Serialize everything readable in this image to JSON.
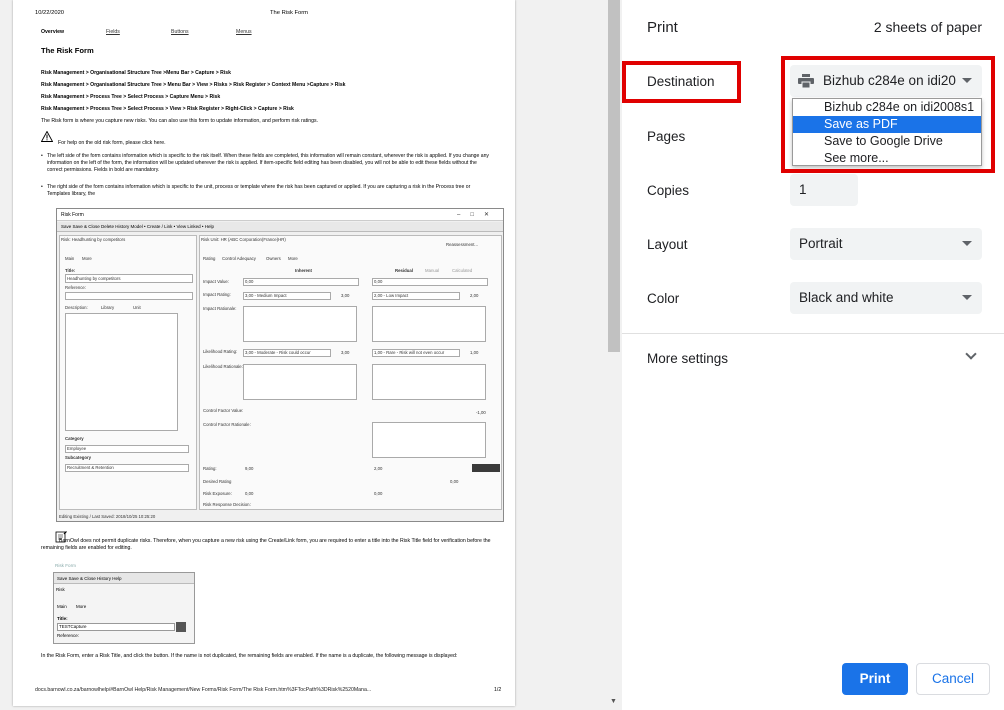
{
  "preview": {
    "header_date": "10/22/2020",
    "header_title": "The Risk Form",
    "nav": [
      "Overview",
      "Fields",
      "Buttons",
      "Menus"
    ],
    "doc_title": "The Risk Form",
    "crumbs": [
      "Risk Management > Organisational Structure Tree >Menu Bar > Capture > Risk",
      "Risk Management > Organisational Structure Tree > Menu Bar > View > Risks > Risk Register > Context Menu >Capture > Risk",
      "Risk Management > Process Tree > Select Process > Capture Menu > Risk",
      "Risk Management > Process Tree > Select Process > View > Risk Register > Right-Click > Capture > Risk"
    ],
    "intro": "The Risk form is where you capture new risks. You can also use this form to update information, and perform risk ratings.",
    "help_text": "For help on the old risk form, please click here.",
    "bullets": [
      "The left side of the form contains information which is specific to the risk itself. When these fields are completed, this information will remain constant, wherever the risk is applied. If you change any information on the left of the form, the information will be updated wherever the risk is applied. If item-specific field editing has been disabled, you will not be able to edit these fields without the correct permissions. Fields in bold are mandatory.",
      "The right side of the form contains information which is specific to the unit, process or template where the risk has been captured or applied. If you are capturing a risk in the Process tree or Templates library, the"
    ],
    "shot": {
      "window_title": "Risk Form",
      "toolbar": "Save  Save & Close  Delete  History  Model • Create / Link • View Linked •  Help",
      "left_header": "Risk: Headhunting by competitors",
      "right_header": "Risk Unit: HR (ABC Corporation(France)HR)",
      "tabs_left": [
        "Main",
        "More"
      ],
      "tabs_right": [
        "Rating",
        "Control Adequacy",
        "Owners",
        "More"
      ],
      "reassessment": "Reassessment...",
      "title_label": "Title:",
      "title_value": "Headhunting by competitors",
      "reference_label": "Reference:",
      "description_label": "Description:",
      "library": "Library",
      "unit": "Unit",
      "inherent": "Inherent",
      "residual": "Residual",
      "manual": "Manual",
      "calculated": "Calculated",
      "impact_value_label": "Impact Value:",
      "impact_value_inh": "0,00",
      "impact_value_res": "0,00",
      "impact_rating_label": "Impact Rating:",
      "impact_inh": "3,00 - Medium Impact",
      "impact_inh_num": "3,00",
      "impact_res": "2,00 - Low Impact",
      "impact_res_num": "2,00",
      "impact_rationale": "Impact Rationale:",
      "likelihood_label": "Likelihood Rating:",
      "likelihood_inh": "3,00 - Moderate - Risk could occur",
      "likelihood_inh_num": "3,00",
      "likelihood_res": "1,00 - Rare - Risk will not even occur",
      "likelihood_res_num": "1,00",
      "likelihood_rationale": "Likelihood Rationale:",
      "control_factor_value": "Control Factor Value:",
      "control_factor_num": "-1,00",
      "control_factor_rationale": "Control Factor Rationale:",
      "category_label": "Category",
      "category_value": "Employee",
      "subcategory_label": "Subcategory",
      "subcategory_value": "Recruitment & Retention",
      "rating_label": "Rating:",
      "rating_inh": "9,00",
      "rating_res": "2,00",
      "desired_rating_label": "Desired Rating",
      "desired_rating": "0,00",
      "risk_exposure_label": "Risk Exposure:",
      "risk_exposure_inh": "0,00",
      "risk_exposure_res": "0,00",
      "risk_response_label": "Risk Response Decision:",
      "status": "Editing Existing / Last Saved: 2018/10/25 10:25:20"
    },
    "dup_note": "BarnOwl does not permit duplicate risks. Therefore, when you capture a new risk using the Create/Link form, you are required to enter a title into the Risk Title field for verification before the remaining fields are enabled for editing.",
    "shot2": {
      "caption": "Risk Form",
      "toolbar": "Save  Save & Close  History  Help",
      "risk_label": "Risk",
      "tabs": [
        "Main",
        "More"
      ],
      "title_label": "Title:",
      "title_value": "TESTCapture",
      "reference_label": "Reference:"
    },
    "final_para": "In the Risk Form, enter a Risk Title, and click the button. If the name is not duplicated, the remaining fields are enabled. If the name is a duplicate, the following message is displayed:",
    "footer_url": "docs.barnowl.co.za/barnowlhelp/#BarnOwl Help/Risk Management/New Forms/Risk Form/The Risk Form.htm%3FTocPath%3DRisk%2520Mana...",
    "page_num": "1/2"
  },
  "panel": {
    "title": "Print",
    "sheets": "2 sheets of paper",
    "destination_label": "Destination",
    "destination_value": "Bizhub c284e on idi20",
    "dropdown_options": [
      "Bizhub c284e on idi2008s1",
      "Save as PDF",
      "Save to Google Drive",
      "See more..."
    ],
    "selected_option": "Save as PDF",
    "pages_label": "Pages",
    "copies_label": "Copies",
    "copies_value": "1",
    "layout_label": "Layout",
    "layout_value": "Portrait",
    "color_label": "Color",
    "color_value": "Black and white",
    "more_settings": "More settings",
    "print_button": "Print",
    "cancel_button": "Cancel"
  },
  "colors": {
    "accent": "#1a73e8",
    "annotation": "#e00000",
    "select_bg": "#f1f3f4"
  }
}
